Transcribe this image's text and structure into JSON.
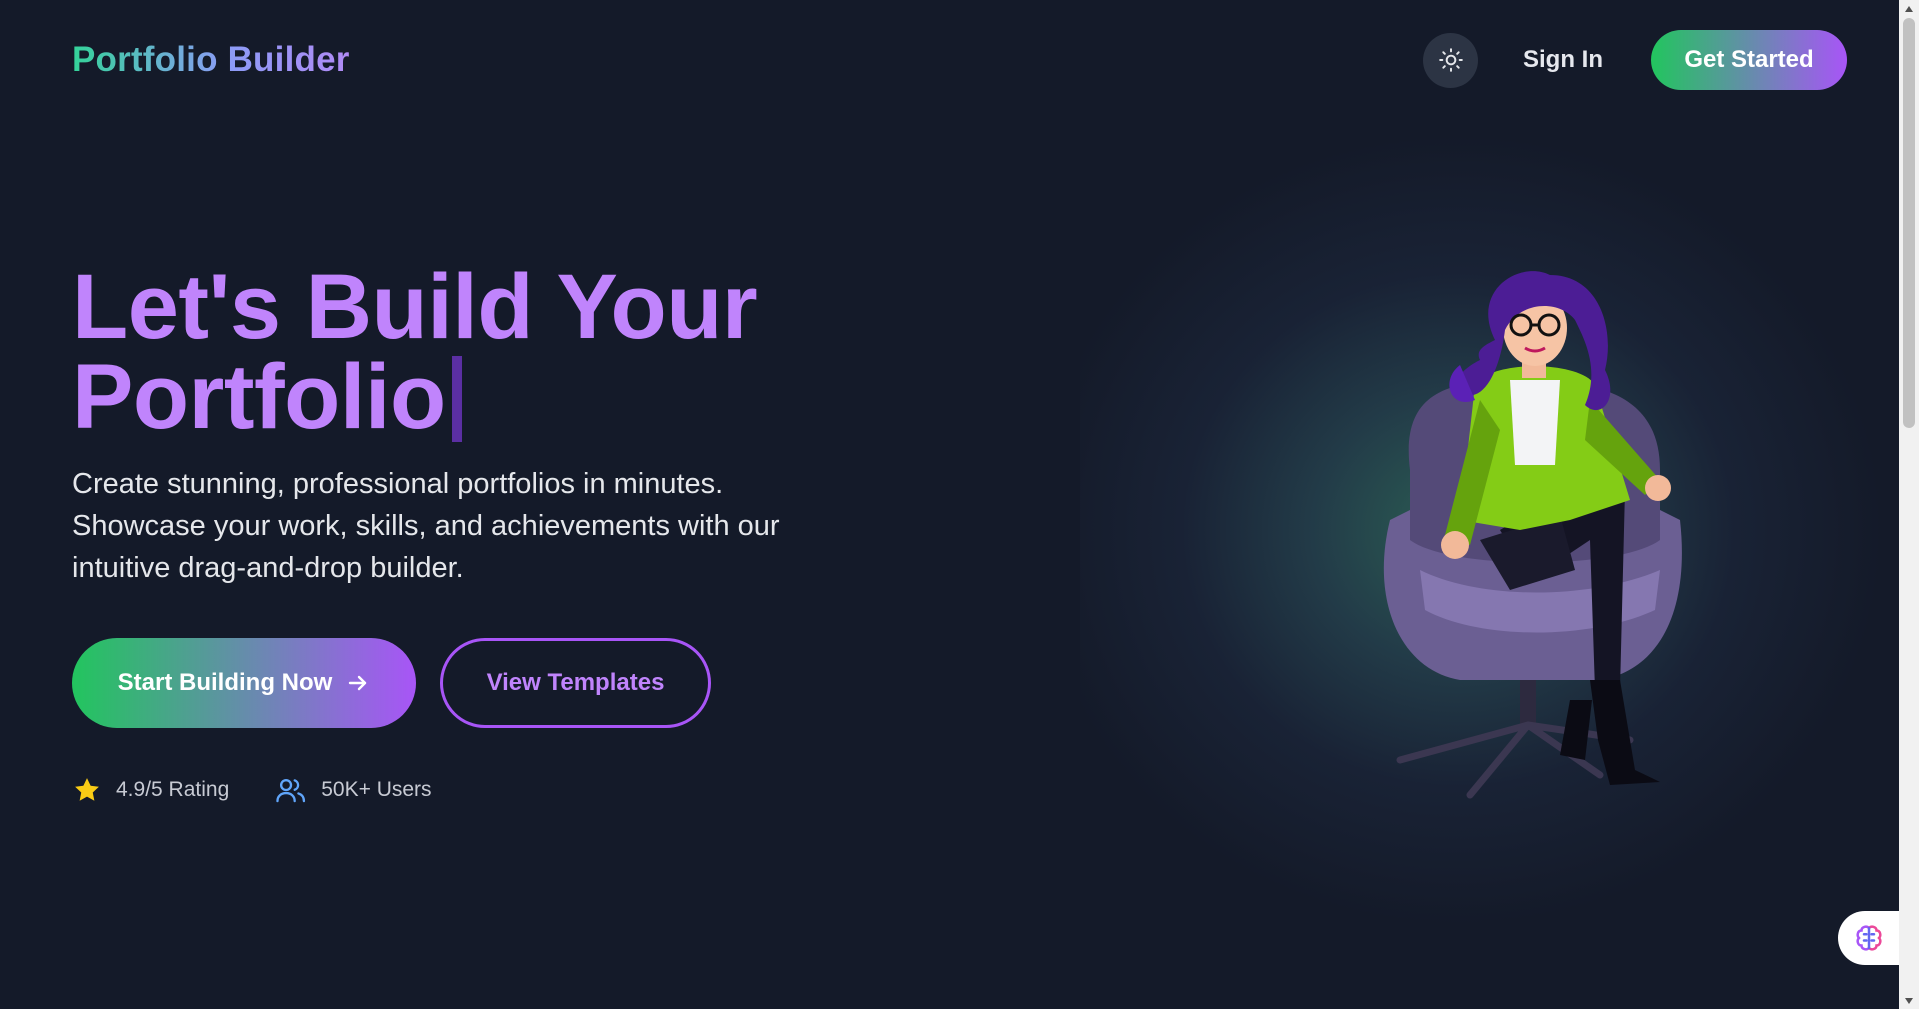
{
  "nav": {
    "brand": "Portfolio Builder",
    "theme_toggle_icon": "sun-icon",
    "signin_label": "Sign In",
    "getstarted_label": "Get Started"
  },
  "hero": {
    "title_line1": "Let's Build Your",
    "title_line2": "Portfolio",
    "subtitle": "Create stunning, professional portfolios in minutes. Showcase your work, skills, and achievements with our intuitive drag-and-drop builder.",
    "primary_cta": "Start Building Now",
    "secondary_cta": "View Templates"
  },
  "stats": [
    {
      "icon": "star-icon",
      "text": "4.9/5 Rating"
    },
    {
      "icon": "users-icon",
      "text": "50K+ Users"
    }
  ],
  "colors": {
    "background": "#141a29",
    "accent_purple": "#c084fc",
    "accent_green": "#22c55e",
    "star": "#facc15",
    "users_icon": "#60a5fa"
  },
  "widget": {
    "icon": "brain-icon"
  }
}
